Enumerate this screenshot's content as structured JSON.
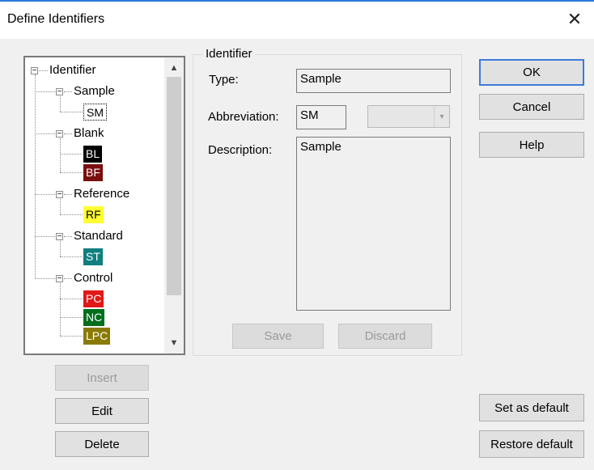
{
  "window": {
    "title": "Define Identifiers",
    "close_glyph": "✕"
  },
  "tree": {
    "root": "Identifier",
    "groups": [
      {
        "label": "Sample",
        "items": [
          {
            "abbr": "SM",
            "bg": "#ffffff",
            "fg": "#000000"
          }
        ]
      },
      {
        "label": "Blank",
        "items": [
          {
            "abbr": "BL",
            "bg": "#000000",
            "fg": "#ffffff"
          },
          {
            "abbr": "BF",
            "bg": "#7a0f0f",
            "fg": "#ffffff"
          }
        ]
      },
      {
        "label": "Reference",
        "items": [
          {
            "abbr": "RF",
            "bg": "#ffff33",
            "fg": "#000000"
          }
        ]
      },
      {
        "label": "Standard",
        "items": [
          {
            "abbr": "ST",
            "bg": "#0f7f7f",
            "fg": "#ffffff"
          }
        ]
      },
      {
        "label": "Control",
        "items": [
          {
            "abbr": "PC",
            "bg": "#e01818",
            "fg": "#ffffff"
          },
          {
            "abbr": "NC",
            "bg": "#006f1c",
            "fg": "#ffffff"
          },
          {
            "abbr": "LPC",
            "bg": "#8a7a00",
            "fg": "#ffffff"
          }
        ]
      }
    ]
  },
  "identifier_group": {
    "title": "Identifier",
    "type_label": "Type:",
    "type_value": "Sample",
    "abbr_label": "Abbreviation:",
    "abbr_value": "SM",
    "desc_label": "Description:",
    "desc_value": "Sample",
    "save_label": "Save",
    "discard_label": "Discard"
  },
  "buttons": {
    "ok": "OK",
    "cancel": "Cancel",
    "help": "Help",
    "insert": "Insert",
    "edit": "Edit",
    "delete": "Delete",
    "set_default": "Set as default",
    "restore_default": "Restore default"
  },
  "colors": {
    "accent": "#3d7bd8"
  }
}
